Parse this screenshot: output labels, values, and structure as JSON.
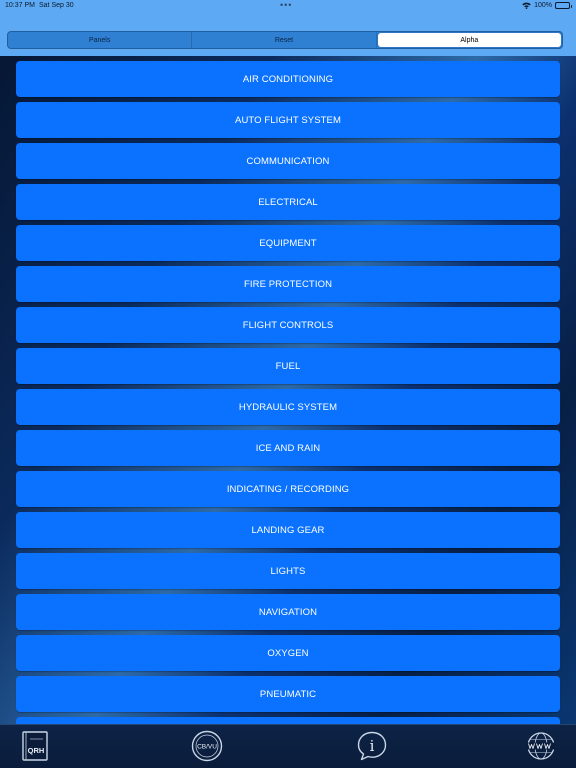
{
  "status_bar": {
    "time": "10:37 PM",
    "date": "Sat Sep 30",
    "dots": "•••",
    "battery": "100%"
  },
  "segmented": {
    "options": [
      "Panels",
      "Reset",
      "Alpha"
    ],
    "selected": "Alpha"
  },
  "list": {
    "items": [
      "AIR CONDITIONING",
      "AUTO FLIGHT SYSTEM",
      "COMMUNICATION",
      "ELECTRICAL",
      "EQUIPMENT",
      "FIRE PROTECTION",
      "FLIGHT CONTROLS",
      "FUEL",
      "HYDRAULIC SYSTEM",
      "ICE AND RAIN",
      "INDICATING / RECORDING",
      "LANDING GEAR",
      "LIGHTS",
      "NAVIGATION",
      "OXYGEN",
      "PNEUMATIC"
    ]
  },
  "tab_bar": {
    "qrh_label": "QRH",
    "cbvu_label": "CB/VU",
    "info_label": "i",
    "icons": [
      "qrh-book-icon",
      "cb-vu-icon",
      "info-bubble-icon",
      "globe-www-icon"
    ]
  },
  "colors": {
    "button_blue": "#0a72ff",
    "top_bar_blue": "#5ea9f3",
    "tab_bar": "#0d2347"
  }
}
